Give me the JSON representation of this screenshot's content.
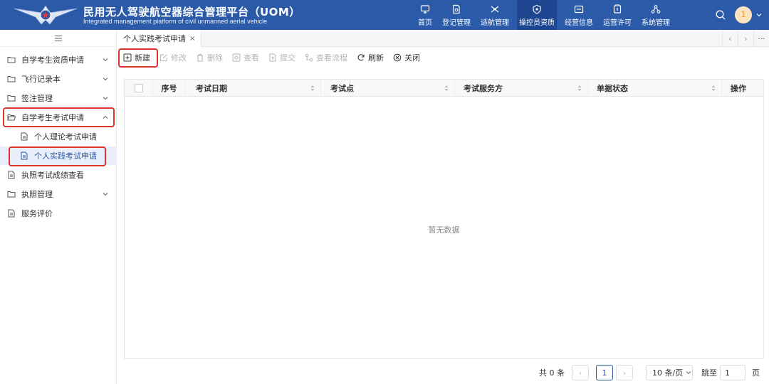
{
  "header": {
    "title": "民用无人驾驶航空器综合管理平台（UOM）",
    "subtitle": "Integrated management platform of civil unmanned aerial vehicle",
    "nav": [
      {
        "label": "首页",
        "icon": "monitor-icon"
      },
      {
        "label": "登记管理",
        "icon": "doc-search-icon"
      },
      {
        "label": "适航管理",
        "icon": "drone-icon"
      },
      {
        "label": "操控员资质",
        "icon": "shield-icon",
        "active": true
      },
      {
        "label": "经营信息",
        "icon": "card-icon"
      },
      {
        "label": "运营许可",
        "icon": "permit-icon"
      },
      {
        "label": "系统管理",
        "icon": "network-icon"
      }
    ],
    "avatar_text": "1"
  },
  "sidebar": {
    "items": [
      {
        "label": "自学考生资质申请"
      },
      {
        "label": "飞行记录本"
      },
      {
        "label": "签注管理"
      },
      {
        "label": "自学考生考试申请"
      },
      {
        "label": "个人理论考试申请"
      },
      {
        "label": "个人实践考试申请"
      },
      {
        "label": "执照考试成绩查看"
      },
      {
        "label": "执照管理"
      },
      {
        "label": "服务评价"
      }
    ]
  },
  "tabs": {
    "active_label": "个人实践考试申请",
    "close_glyph": "×"
  },
  "toolbar": {
    "new": "新建",
    "edit": "修改",
    "delete": "删除",
    "view": "查看",
    "submit": "提交",
    "view_flow": "查看流程",
    "refresh": "刷新",
    "close": "关闭"
  },
  "table": {
    "columns": {
      "index": "序号",
      "exam_date": "考试日期",
      "exam_site": "考试点",
      "provider": "考试服务方",
      "status": "单据状态",
      "actions": "操作"
    },
    "empty_text": "暂无数据"
  },
  "pager": {
    "total": "共 0 条",
    "current_page": "1",
    "page_size": "10 条/页",
    "goto_label": "跳至",
    "goto_value": "1",
    "page_unit": "页"
  },
  "colors": {
    "header_bg": "#2a5aa8",
    "active_nav": "#1e4690",
    "highlight": "#e0332e",
    "accent": "#2a5aa8"
  }
}
